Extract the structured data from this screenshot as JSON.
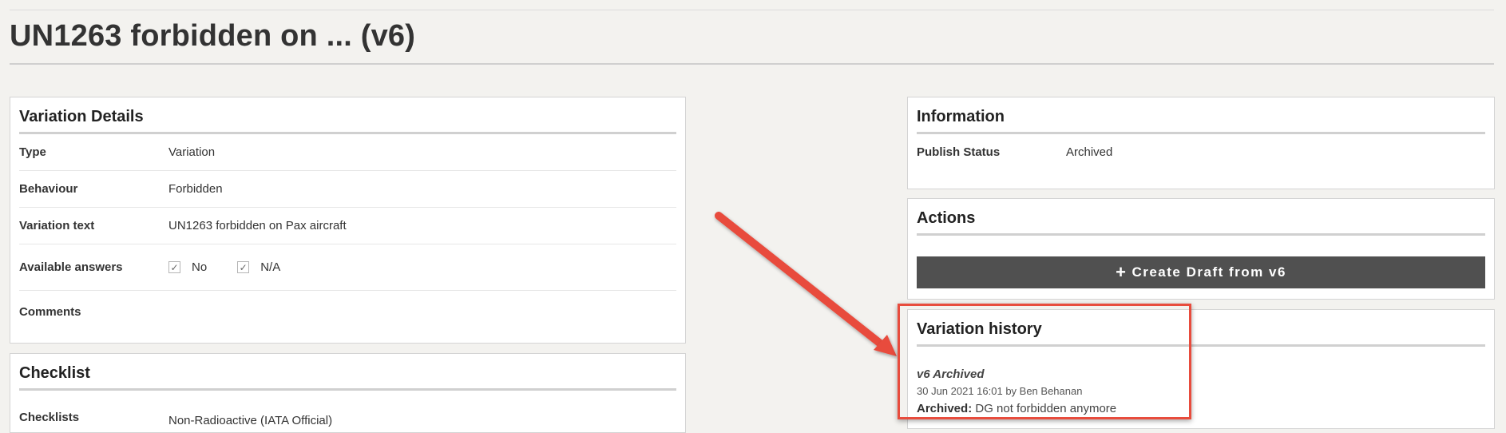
{
  "page": {
    "title": "UN1263 forbidden on ... (v6)"
  },
  "variation_details": {
    "title": "Variation Details",
    "rows": [
      {
        "label": "Type",
        "value": "Variation"
      },
      {
        "label": "Behaviour",
        "value": "Forbidden"
      },
      {
        "label": "Variation text",
        "value": "UN1263 forbidden on Pax aircraft"
      }
    ],
    "available_answers": {
      "label": "Available answers",
      "options": [
        {
          "label": "No",
          "checked": true
        },
        {
          "label": "N/A",
          "checked": true
        }
      ]
    },
    "comments": {
      "label": "Comments",
      "value": ""
    }
  },
  "checklist": {
    "title": "Checklist",
    "rows": [
      {
        "label": "Checklists",
        "value": "Non-Radioactive (IATA Official)"
      }
    ]
  },
  "information": {
    "title": "Information",
    "rows": [
      {
        "label": "Publish Status",
        "value": "Archived"
      }
    ]
  },
  "actions": {
    "title": "Actions",
    "create_draft_label": "Create Draft from v6",
    "create_draft_icon": "plus-icon"
  },
  "variation_history": {
    "title": "Variation history",
    "entries": [
      {
        "heading": "v6 Archived",
        "meta": "30 Jun 2021 16:01 by Ben Behanan",
        "note_label": "Archived:",
        "note_text": "DG not forbidden anymore"
      }
    ]
  },
  "annotation": {
    "arrow_color": "#e84c3d",
    "highlight_color": "#e84c3d"
  }
}
